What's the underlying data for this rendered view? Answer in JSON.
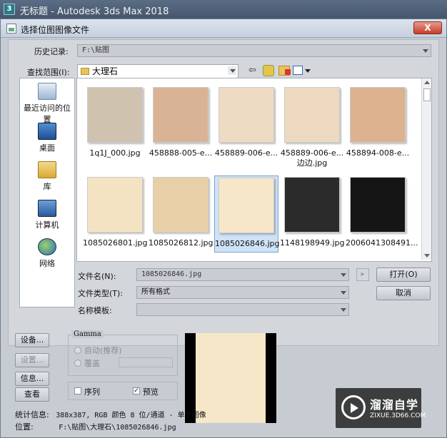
{
  "app_title": "无标题 - Autodesk 3ds Max 2018",
  "app_icon": "3",
  "dialog": {
    "title": "选择位图图像文件",
    "close_label": "X"
  },
  "history": {
    "label": "历史记录:",
    "value": "F:\\贴图"
  },
  "lookin": {
    "label": "查找范围(I):",
    "value": "大理石"
  },
  "places": [
    {
      "label": "最近访问的位置",
      "icon": "recent-places-icon"
    },
    {
      "label": "桌面",
      "icon": "desktop-icon"
    },
    {
      "label": "库",
      "icon": "library-icon"
    },
    {
      "label": "计算机",
      "icon": "computer-icon"
    },
    {
      "label": "网络",
      "icon": "network-icon"
    }
  ],
  "files": [
    {
      "name": "1q1J_000.jpg",
      "name2": "",
      "color": "#cfc2ae"
    },
    {
      "name": "458888-005-e...",
      "name2": "",
      "color": "#d9b396"
    },
    {
      "name": "458889-006-e...",
      "name2": "",
      "color": "#eedbc3"
    },
    {
      "name": "458889-006-e...",
      "name2": "边边.jpg",
      "color": "#ecd9bf"
    },
    {
      "name": "458894-008-e...",
      "name2": "",
      "color": "#ddb28f"
    },
    {
      "name": "1085026801.jpg",
      "name2": "",
      "color": "#f3e3c2"
    },
    {
      "name": "1085026812.jpg",
      "name2": "",
      "color": "#e8cfa8"
    },
    {
      "name": "1085026846.jpg",
      "name2": "",
      "color": "#f6e7c9"
    },
    {
      "name": "1148198949.jpg",
      "name2": "",
      "color": "#2b2b2b"
    },
    {
      "name": "2006041308491...",
      "name2": "",
      "color": "#151515"
    }
  ],
  "selected_index": 7,
  "filename": {
    "label": "文件名(N):",
    "value": "1085026846.jpg"
  },
  "filetype": {
    "label": "文件类型(T):",
    "value": "所有格式"
  },
  "template": {
    "label": "名称模板:"
  },
  "buttons": {
    "open": "打开(O)",
    "cancel": "取消",
    "setup": "设备...",
    "settings": "设置...",
    "info": "信息...",
    "view": "查看"
  },
  "gamma": {
    "title": "Gamma",
    "auto": "自动(推荐)",
    "override": "覆盖"
  },
  "sequence_label": "序列",
  "preview_label": "预览",
  "preview_checked": true,
  "stats": {
    "label": "统计信息:",
    "value": "388x387, RGB 颜色 8 位/通道 - 单个图像"
  },
  "location": {
    "label": "位置:",
    "value": "F:\\贴图\\大理石\\1085026846.jpg"
  },
  "watermark": {
    "title": "溜溜自学",
    "url": "ZIXUE.3D66.COM"
  }
}
